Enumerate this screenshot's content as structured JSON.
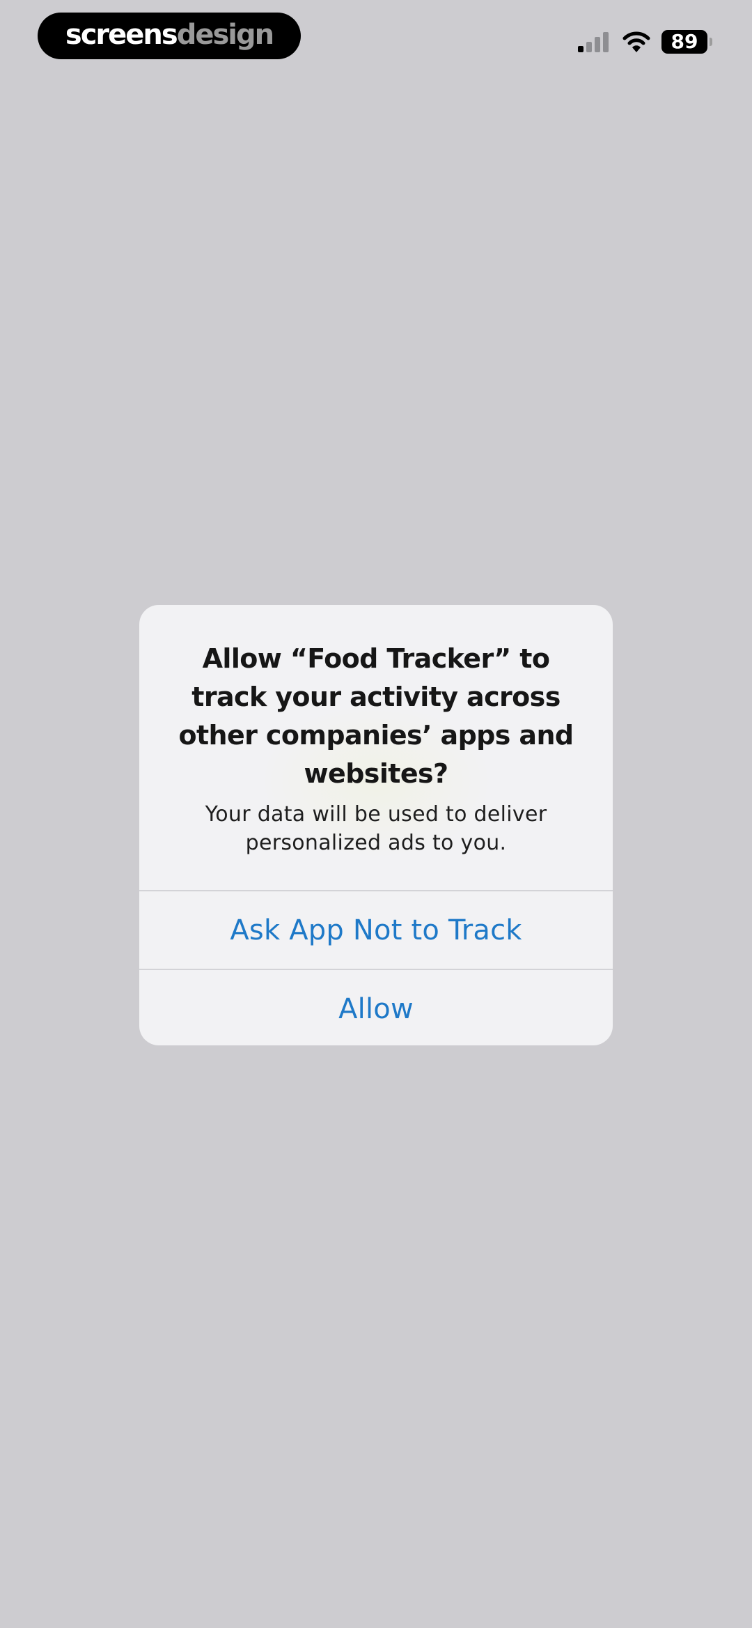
{
  "status_bar": {
    "brand": {
      "part1": "screens",
      "part2": "design"
    },
    "battery": "89",
    "icons": [
      "signal-icon",
      "wifi-icon",
      "battery-icon"
    ]
  },
  "alert": {
    "title": "Allow “Food Tracker” to track your activity across other companies’ apps and websites?",
    "message": "Your data will be used to deliver personalized ads to you.",
    "buttons": {
      "ask_not_to_track": "Ask App Not to Track",
      "allow": "Allow"
    }
  },
  "colors": {
    "background": "#cdccd0",
    "alert_background": "#f2f2f4",
    "action_blue": "#1e79c8",
    "divider": "#d3d3d7"
  }
}
